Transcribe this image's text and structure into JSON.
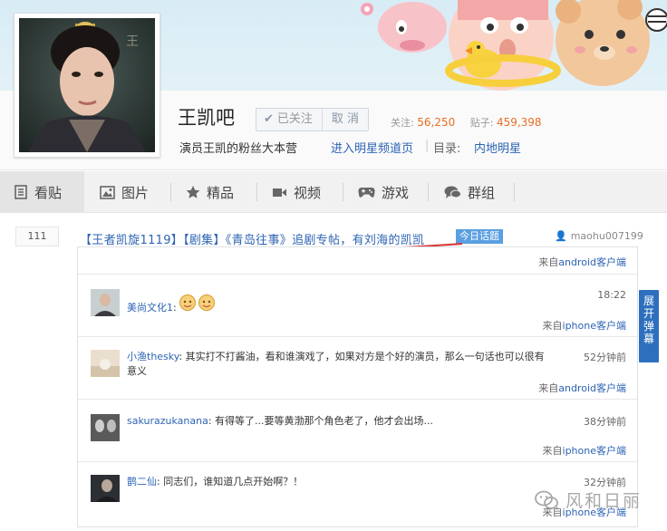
{
  "forum": {
    "name": "王凯吧",
    "follow_label": "已关注",
    "unfollow_label": "取 消",
    "stats": {
      "follow_label": "关注:",
      "follow_count": "56,250",
      "posts_label": "贴子:",
      "posts_count": "459,398"
    },
    "slogan": "演员王凯的粉丝大本营",
    "star_link": "进入明星频道页",
    "sep": "|",
    "dir_label": "目录:",
    "dir_value": "内地明星"
  },
  "nav": {
    "tabs": [
      {
        "label": "看贴",
        "icon": "document-icon"
      },
      {
        "label": "图片",
        "icon": "image-icon"
      },
      {
        "label": "精品",
        "icon": "star-icon"
      },
      {
        "label": "视频",
        "icon": "video-icon"
      },
      {
        "label": "游戏",
        "icon": "gamepad-icon"
      },
      {
        "label": "群组",
        "icon": "chat-icon"
      }
    ]
  },
  "thread": {
    "reply_count": "111",
    "title": "【王者凯旋1119】【剧集】《青岛往事》追剧专帖，有刘海的凯凯",
    "tag": "今日话题",
    "author": "maohu007199"
  },
  "comments": [
    {
      "user": "",
      "text": "",
      "time": "",
      "source_prefix": "来自",
      "source_link": "android客户端"
    },
    {
      "user": "美尚文化1",
      "text": ":",
      "emoji": "😇😇",
      "time": "18:22",
      "source_prefix": "来自",
      "source_link": "iphone客户端"
    },
    {
      "user": "小渔thesky",
      "text": ": 其实打不打酱油，看和谁演戏了，如果对方是个好的演员，那么一句话也可以很有意义",
      "time": "52分钟前",
      "source_prefix": "来自",
      "source_link": "android客户端"
    },
    {
      "user": "sakurazukanana",
      "text": ": 有得等了...要等黄渤那个角色老了，他才会出场...",
      "time": "38分钟前",
      "source_prefix": "来自",
      "source_link": "iphone客户端"
    },
    {
      "user": "鹊二仙",
      "text": ": 同志们，谁知道几点开始啊？！",
      "time": "32分钟前",
      "source_prefix": "来自",
      "source_link": "iphone客户端"
    }
  ],
  "danmu": {
    "chars": [
      "展",
      "开",
      "弹",
      "幕"
    ]
  },
  "watermark": "风和日丽",
  "colors": {
    "link": "#2d64b3",
    "accent": "#e96e22",
    "danmu": "#2e6fbd"
  }
}
